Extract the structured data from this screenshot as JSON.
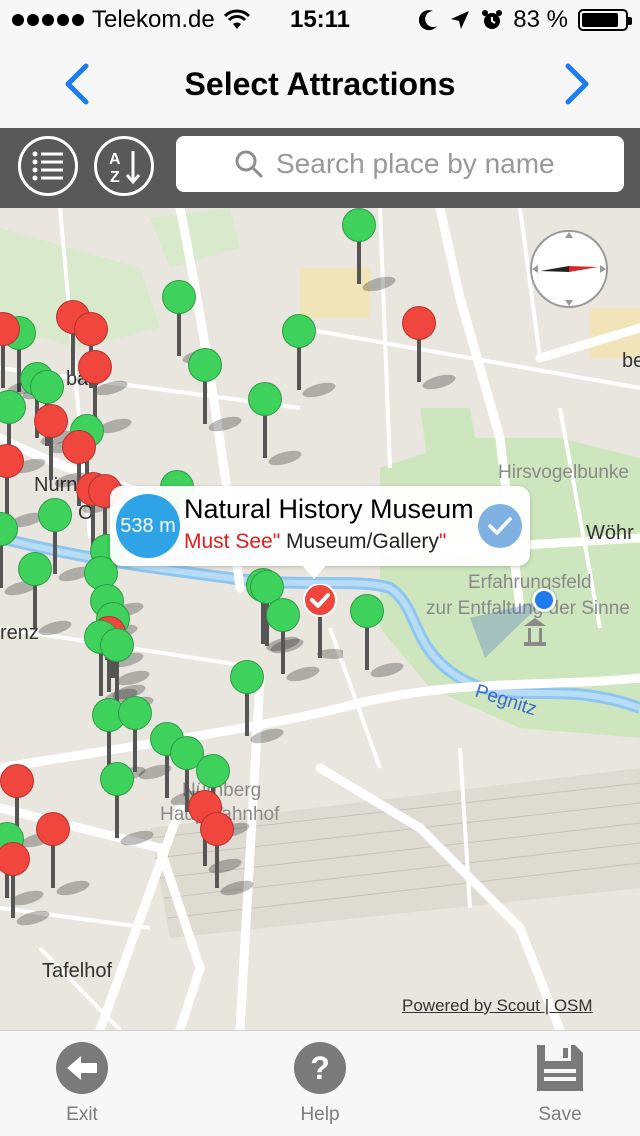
{
  "status_bar": {
    "carrier": "Telekom.de",
    "time": "15:11",
    "battery_percent": "83 %",
    "icons": [
      "signal-dots-icon",
      "wifi-icon",
      "moon-icon",
      "location-arrow-icon",
      "alarm-icon",
      "battery-icon"
    ]
  },
  "nav": {
    "title": "Select Attractions",
    "back_icon": "chevron-left-icon",
    "forward_icon": "chevron-right-icon"
  },
  "toolbar": {
    "list_icon": "list-icon",
    "sort_icon": "sort-a-z-icon",
    "search_placeholder": "Search place by name",
    "search_value": ""
  },
  "map": {
    "labels": {
      "bad": "bad",
      "nurnberg": "Nürnberg",
      "o": "O",
      "renz": "renz",
      "tafelhof": "Tafelhof",
      "hirsvogelbunker": "Hirsvogelbunke",
      "wohr": "Wöhr",
      "be": "be",
      "erfahrungsfeld": "Erfahrungsfeld",
      "zur_entfaltung": "zur Entfaltung der Sinne",
      "pegnitz": "Pegnitz",
      "nurnberg_hbf_1": "Nürnberg",
      "nurnberg_hbf_2": "Hauptbahnhof"
    },
    "callout": {
      "distance": "538 m",
      "name": "Natural History Museum",
      "category": "Museum/Gallery",
      "tag": "\"Must See\"",
      "selected": true
    },
    "attribution": "Powered by Scout | OSM",
    "colors": {
      "green_pin": "#3ed15c",
      "red_pin": "#f0463e",
      "callout_distance": "#2ea3e6",
      "must_see": "#e31b1b"
    }
  },
  "bottom_bar": {
    "exit_label": "Exit",
    "help_label": "Help",
    "save_label": "Save"
  }
}
